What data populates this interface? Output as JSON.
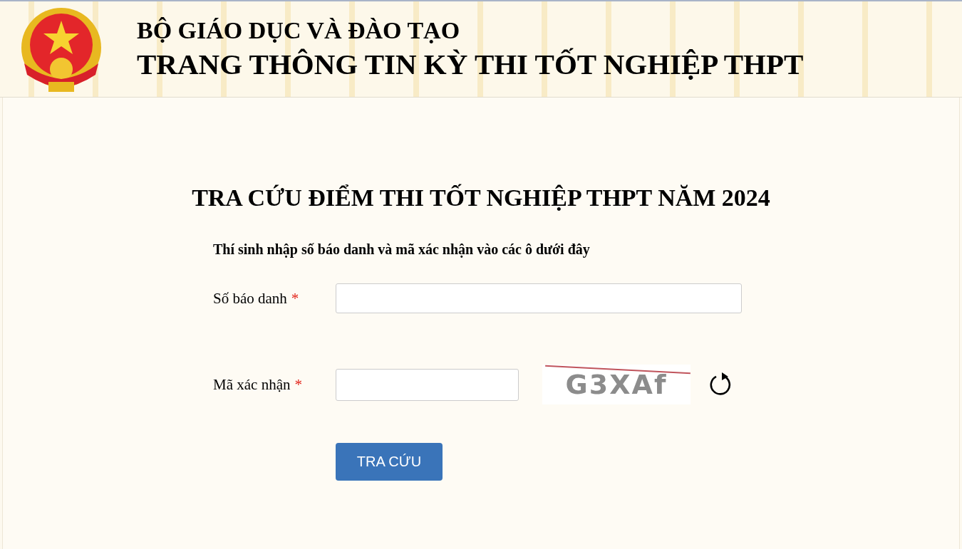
{
  "header": {
    "ministry": "BỘ GIÁO DỤC VÀ ĐÀO TẠO",
    "site_title": "TRANG THÔNG TIN KỲ THI TỐT NGHIỆP THPT"
  },
  "form": {
    "title": "TRA CỨU ĐIỂM THI TỐT NGHIỆP THPT NĂM 2024",
    "instruction": "Thí sinh nhập số báo danh và mã xác nhận vào các ô dưới đây",
    "fields": [
      {
        "kind": "text",
        "label": "Số báo danh",
        "required_mark": "*"
      },
      {
        "kind": "captcha",
        "label": "Mã xác nhận",
        "required_mark": "*",
        "captcha": "G3XAf"
      }
    ],
    "button": "TRA CỨU"
  }
}
